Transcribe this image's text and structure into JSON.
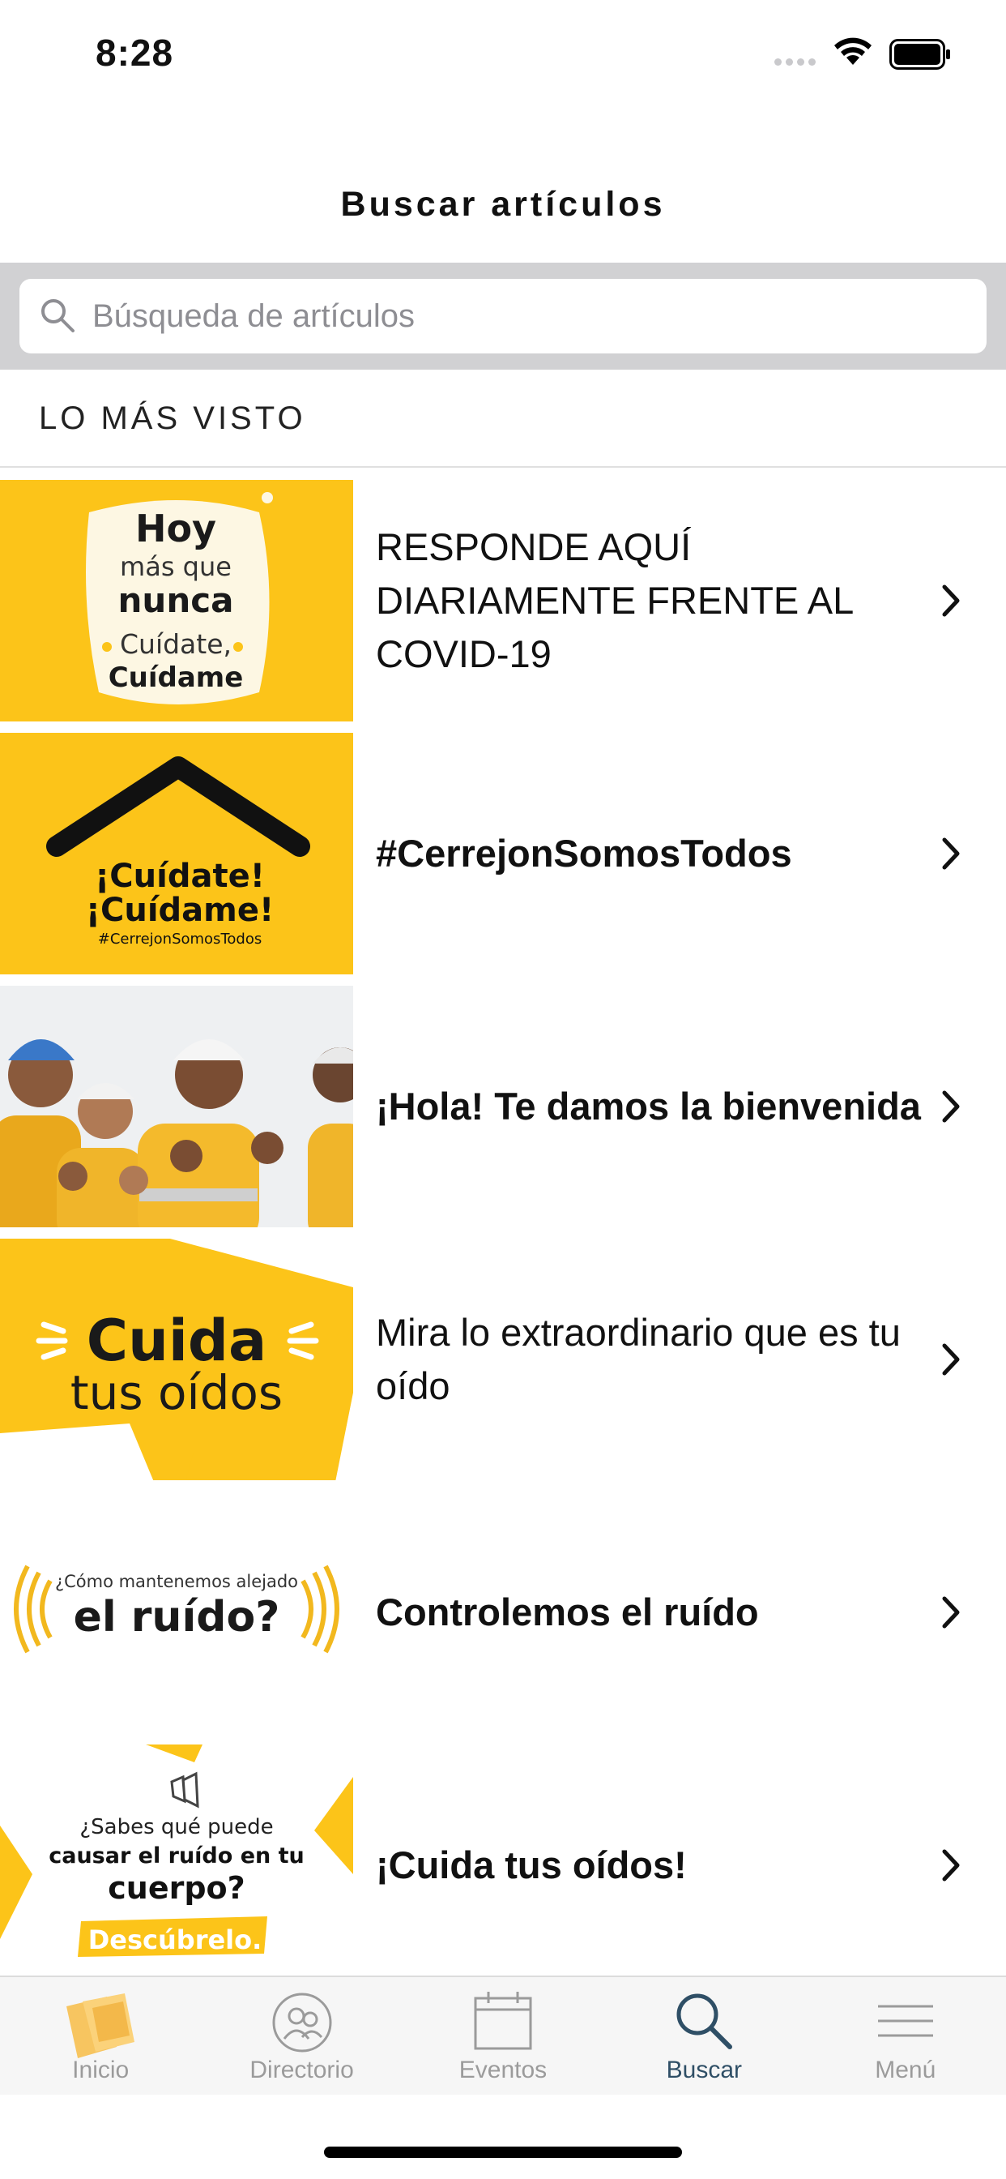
{
  "status_bar": {
    "time": "8:28"
  },
  "nav": {
    "title": "Buscar artículos"
  },
  "search": {
    "placeholder": "Búsqueda de artículos",
    "value": ""
  },
  "section": {
    "title": "LO MÁS VISTO"
  },
  "articles": [
    {
      "title": "RESPONDE AQUÍ DIARIAMENTE FRENTE AL COVID-19",
      "thumb_text": [
        "Hoy",
        "más que",
        "nunca",
        "Cuídate,",
        "Cuídame"
      ]
    },
    {
      "title": "#CerrejonSomosTodos",
      "thumb_text": [
        "¡Cuídate!",
        "¡Cuídame!",
        "#CerrejonSomosTodos"
      ]
    },
    {
      "title": "¡Hola! Te damos la bienvenida",
      "thumb_text": []
    },
    {
      "title": "Mira lo extraordinario que es tu oído",
      "thumb_text": [
        "Cuida",
        "tus oídos"
      ]
    },
    {
      "title": "Controlemos el ruído",
      "thumb_text": [
        "¿Cómo mantenemos alejado",
        "el ruído?"
      ]
    },
    {
      "title": "¡Cuida tus oídos!",
      "thumb_text": [
        "¿Sabes qué puede",
        "causar el ruído en tu",
        "cuerpo?",
        "Descúbrelo."
      ]
    }
  ],
  "tabs": [
    {
      "label": "Inicio",
      "icon": "home-logo-icon",
      "active": false
    },
    {
      "label": "Directorio",
      "icon": "directory-people-icon",
      "active": false
    },
    {
      "label": "Eventos",
      "icon": "calendar-icon",
      "active": false
    },
    {
      "label": "Buscar",
      "icon": "search-icon",
      "active": true
    },
    {
      "label": "Menú",
      "icon": "hamburger-menu-icon",
      "active": false
    }
  ],
  "colors": {
    "brand_yellow": "#fcc419",
    "active_tab": "#2f4f66",
    "inactive_tab": "#9b9b9b",
    "search_band": "#d1d1d3"
  }
}
